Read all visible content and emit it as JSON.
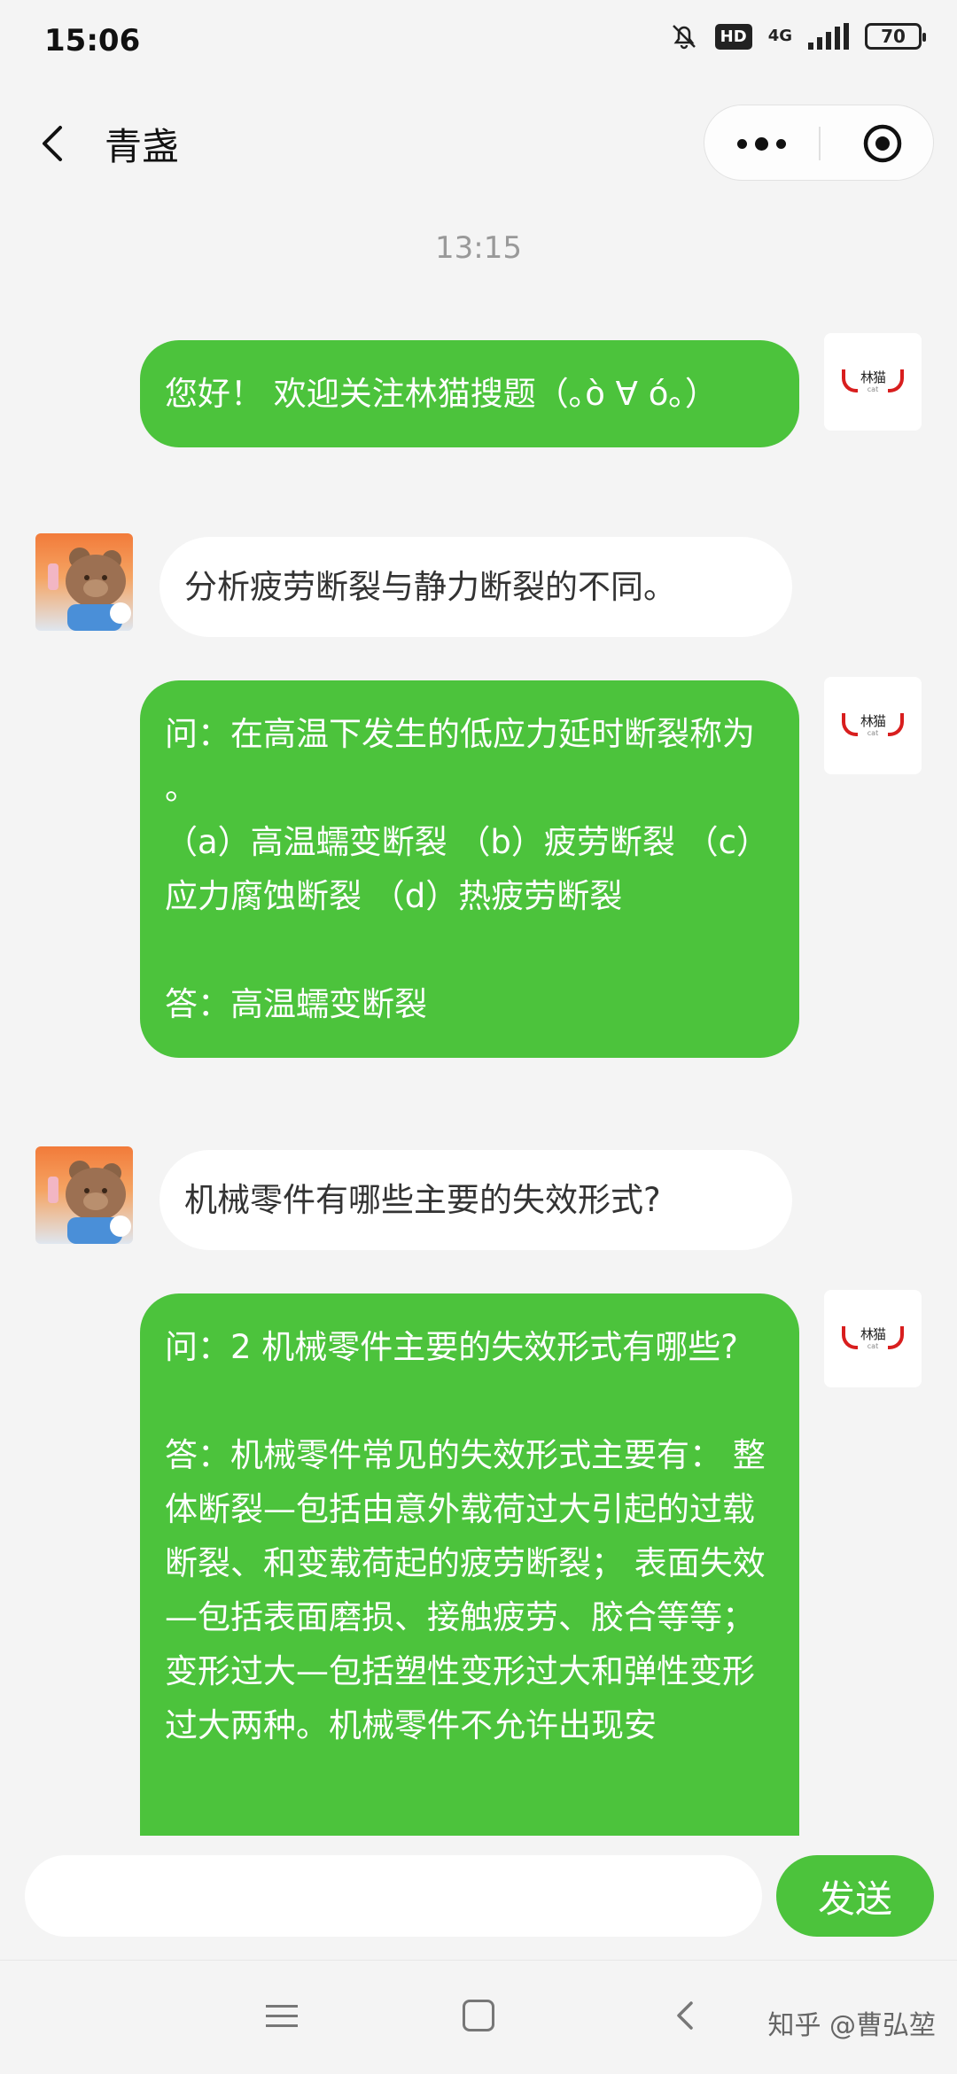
{
  "status_bar": {
    "time": "15:06",
    "hd": "HD",
    "network": "4G",
    "battery": "70"
  },
  "header": {
    "title": "青盏"
  },
  "chat": {
    "timestamp": "13:15",
    "messages": [
      {
        "sender": "bot",
        "text": "您好！ 欢迎关注林猫搜题（｡ò ∀ ó｡）"
      },
      {
        "sender": "user",
        "text": "分析疲劳断裂与静力断裂的不同。"
      },
      {
        "sender": "bot",
        "text": "问：在高温下发生的低应力延时断裂称为 。\n（a）高温蠕变断裂 （b）疲劳断裂 （c）应力腐蚀断裂 （d）热疲劳断裂\n\n答：高温蠕变断裂"
      },
      {
        "sender": "user",
        "text": "机械零件有哪些主要的失效形式?"
      },
      {
        "sender": "bot",
        "text": "问：2 机械零件主要的失效形式有哪些?\n\n答：机械零件常见的失效形式主要有： 整体断裂—包括由意外载荷过大引起的过载断裂、和变载荷起的疲劳断裂； 表面失效—包括表面磨损、接触疲劳、胶合等等； 变形过大—包括塑性变形过大和弹性变形过大两种。机械零件不允许出现安"
      }
    ],
    "bot_avatar": {
      "brand": "林猫",
      "sub": "cat",
      "icon": "linmao-devil-horn-logo"
    },
    "user_avatar": {
      "icon": "bear-avatar"
    }
  },
  "input": {
    "placeholder": "",
    "send_label": "发送"
  },
  "watermark": "知乎 @曹弘堃",
  "colors": {
    "bubble_green": "#4cc33c",
    "background": "#f4f4f4",
    "logo_red": "#d81e1e"
  }
}
